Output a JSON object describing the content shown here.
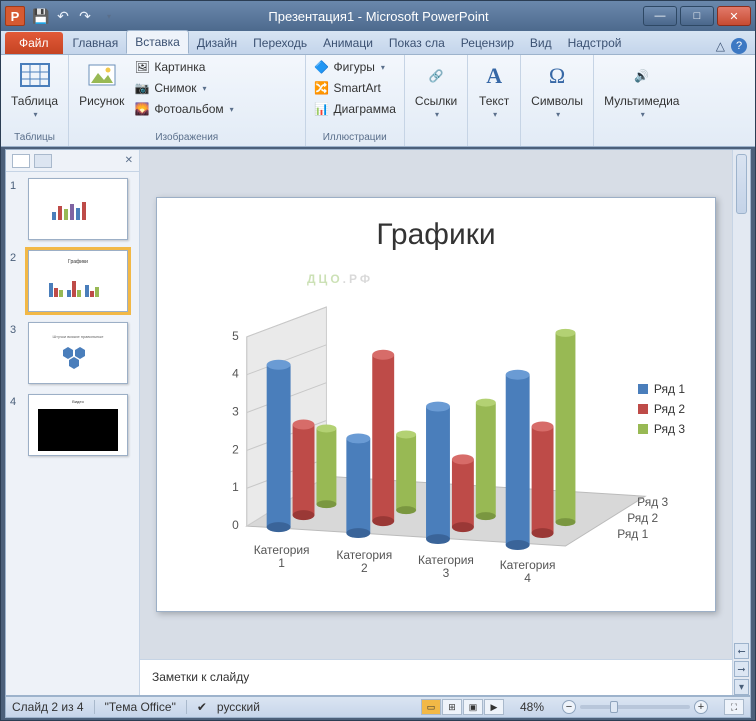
{
  "title": "Презентация1  -  Microsoft PowerPoint",
  "ribbon": {
    "file": "Файл",
    "tabs": [
      "Главная",
      "Вставка",
      "Дизайн",
      "Переходь",
      "Анимаци",
      "Показ сла",
      "Рецензир",
      "Вид",
      "Надстрой"
    ],
    "active_tab_index": 1,
    "groups": {
      "tables": {
        "label": "Таблицы",
        "table": "Таблица"
      },
      "images": {
        "label": "Изображения",
        "picture": "Рисунок",
        "clipart": "Картинка",
        "screenshot": "Снимок",
        "album": "Фотоальбом"
      },
      "illustr": {
        "label": "Иллюстрации",
        "shapes": "Фигуры",
        "smartart": "SmartArt",
        "chart": "Диаграмма"
      },
      "links": {
        "label": "Ссылки",
        "btn": "Ссылки"
      },
      "text": {
        "label": "Текст",
        "btn": "Текст"
      },
      "symbols": {
        "label": "Символы",
        "btn": "Символы"
      },
      "media": {
        "label": "Мультимедиа",
        "btn": "Мультимедиа"
      }
    }
  },
  "slides": {
    "count": 4,
    "selected": 2,
    "titles": [
      "",
      "Графики",
      "",
      ""
    ],
    "current_title": "Графики"
  },
  "chart_data": {
    "type": "bar",
    "title": "Графики",
    "categories": [
      "Категория 1",
      "Категория 2",
      "Категория 3",
      "Категория 4"
    ],
    "series": [
      {
        "name": "Ряд 1",
        "color": "#4a7ebb",
        "values": [
          4.3,
          2.5,
          3.5,
          4.5
        ]
      },
      {
        "name": "Ряд 2",
        "color": "#be4b48",
        "values": [
          2.4,
          4.4,
          1.8,
          2.8
        ]
      },
      {
        "name": "Ряд 3",
        "color": "#98b954",
        "values": [
          2.0,
          2.0,
          3.0,
          5.0
        ]
      }
    ],
    "depth_labels": [
      "Ряд 1",
      "Ряд 2",
      "Ряд 3"
    ],
    "ylim": [
      0,
      5
    ],
    "yticks": [
      0,
      1,
      2,
      3,
      4,
      5
    ]
  },
  "notes_placeholder": "Заметки к слайду",
  "status": {
    "slide_info": "Слайд 2 из 4",
    "theme": "\"Тема Office\"",
    "language": "русский",
    "zoom": "48%"
  },
  "watermark": {
    "a": "ДЦО",
    "b": ".РФ"
  }
}
